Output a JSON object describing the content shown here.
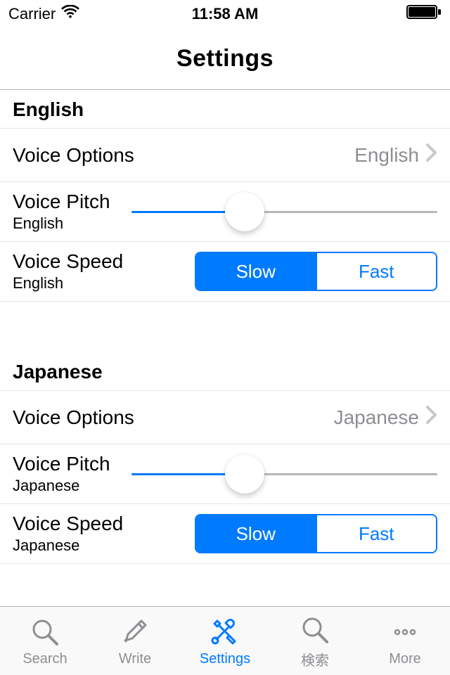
{
  "status": {
    "carrier": "Carrier",
    "time": "11:58 AM"
  },
  "header": {
    "title": "Settings"
  },
  "sections": {
    "english": {
      "title": "English",
      "voice_options": {
        "label": "Voice Options",
        "value": "English"
      },
      "voice_pitch": {
        "label": "Voice Pitch",
        "sub": "English",
        "value": 0.37
      },
      "voice_speed": {
        "label": "Voice Speed",
        "sub": "English",
        "options": {
          "slow": "Slow",
          "fast": "Fast"
        },
        "selected": "slow"
      }
    },
    "japanese": {
      "title": "Japanese",
      "voice_options": {
        "label": "Voice Options",
        "value": "Japanese"
      },
      "voice_pitch": {
        "label": "Voice Pitch",
        "sub": "Japanese",
        "value": 0.37
      },
      "voice_speed": {
        "label": "Voice Speed",
        "sub": "Japanese",
        "options": {
          "slow": "Slow",
          "fast": "Fast"
        },
        "selected": "slow"
      }
    }
  },
  "tabs": {
    "search": "Search",
    "write": "Write",
    "settings": "Settings",
    "search_jp": "検索",
    "more": "More"
  }
}
